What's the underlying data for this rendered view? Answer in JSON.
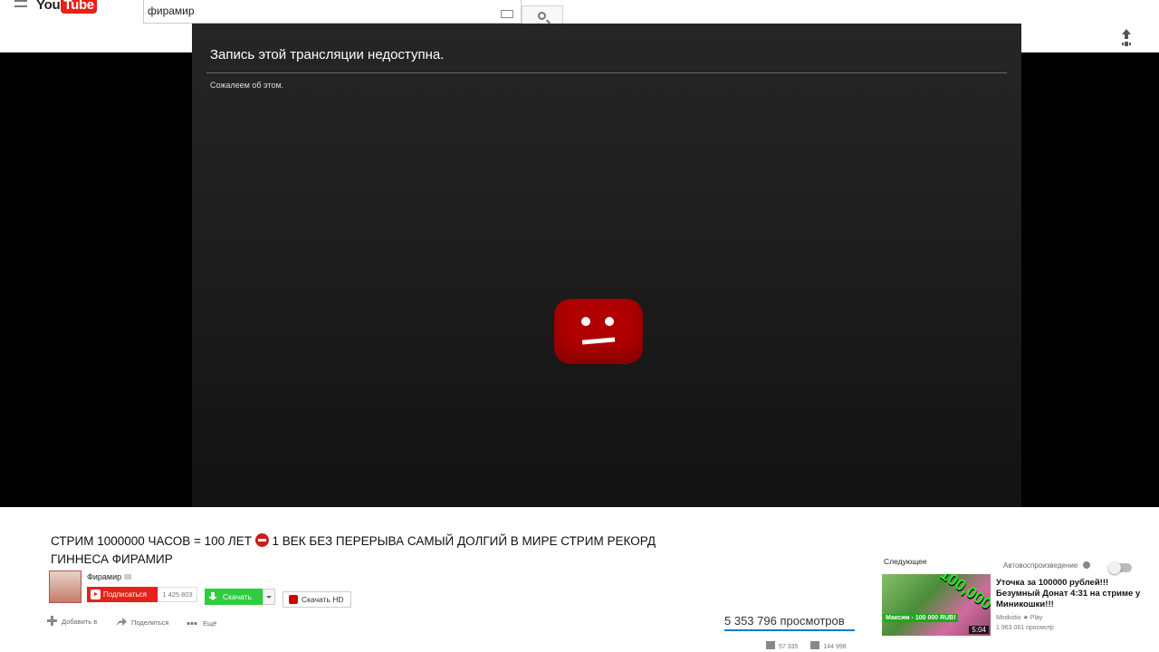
{
  "header": {
    "logo_you": "You",
    "logo_tube": "Tube",
    "search_value": "фирамир"
  },
  "player": {
    "error_title": "Запись этой трансляции недоступна.",
    "error_subtitle": "Сожалеем об этом."
  },
  "video": {
    "title_part1": "СТРИМ 1000000 ЧАСОВ = 100 ЛЕТ",
    "title_part2": " 1 ВЕК БЕЗ ПЕРЕРЫВА САМЫЙ ДОЛГИЙ В МИРЕ СТРИМ РЕКОРД ГИННЕСА ФИРАМИР",
    "channel_name": "Фирамир",
    "subscribe_label": "Подписаться",
    "subscriber_count": "1 425 803",
    "download_label": "Скачать",
    "download_hd_label": "Скачать HD",
    "add_to_label": "Добавить в",
    "share_label": "Поделиться",
    "more_label": "Ещё",
    "views": "5 353 796 просмотров",
    "likes": "57 335",
    "dislikes": "144 998"
  },
  "sidebar": {
    "next_label": "Следующее",
    "autoplay_label": "Автовоспроизведение",
    "next_video": {
      "title": "Уточка за 100000 рублей!!! Безумный Донат 4:31 на стриме у Миникошки!!!",
      "channel": "Minikotio ★ Play",
      "views": "1 963 061 просмотр",
      "duration": "5:04",
      "thumb_caption": "Максим - 100 000 RUB!",
      "thumb_big_text": "100,000"
    }
  },
  "colors": {
    "accent_red": "#e62117",
    "download_green": "#2ecc40",
    "link_blue": "#167ac6"
  }
}
